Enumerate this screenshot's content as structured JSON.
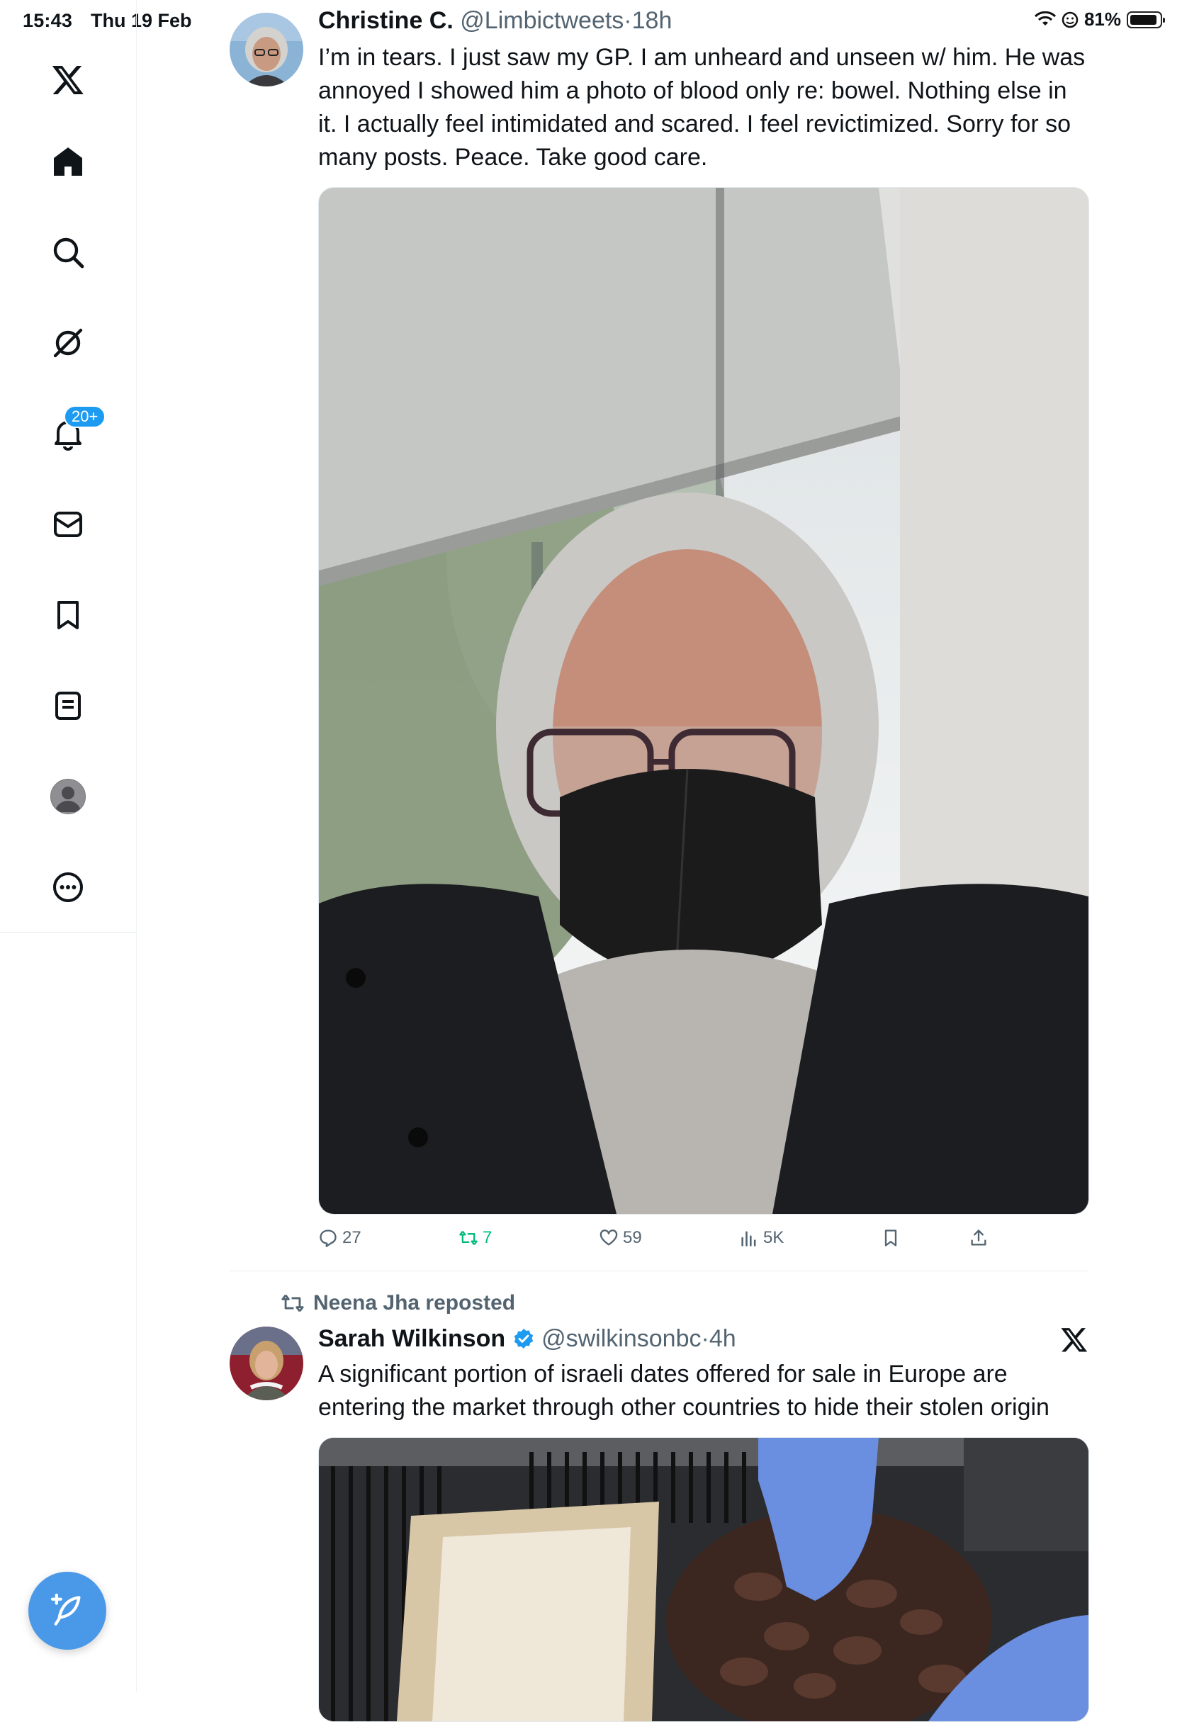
{
  "status_bar": {
    "time": "15:43",
    "date": "Thu 19 Feb",
    "battery": "81%"
  },
  "sidebar": {
    "items": [
      {
        "name": "x-logo-icon"
      },
      {
        "name": "home-icon"
      },
      {
        "name": "search-icon"
      },
      {
        "name": "grok-icon"
      },
      {
        "name": "notifications-icon",
        "badge": "20+"
      },
      {
        "name": "messages-icon"
      },
      {
        "name": "bookmarks-icon"
      },
      {
        "name": "lists-icon"
      },
      {
        "name": "profile-icon"
      },
      {
        "name": "more-icon"
      }
    ]
  },
  "tweets": [
    {
      "display_name": "Christine C.",
      "handle": "@Limbictweets",
      "sep": "·",
      "time": "18h",
      "text": "I’m in tears. I just saw my GP. I am unheard and unseen w/ him. He was annoyed I showed him a photo of blood only re: bowel. Nothing else in it. I actually feel intimidated and scared. I feel revictimized. Sorry for so many posts. Peace. Take good care.",
      "stats": {
        "replies": "27",
        "reposts": "7",
        "likes": "59",
        "views": "5K"
      }
    },
    {
      "reposted_by": "Neena Jha reposted",
      "display_name": "Sarah Wilkinson",
      "handle": "@swilkinsonbc",
      "sep": "·",
      "time": "4h",
      "text": "A significant portion of israeli dates offered for sale in Europe are entering the market through other countries to hide their stolen origin"
    }
  ],
  "colors": {
    "accent": "#1d9bf0",
    "repost_green": "#00ba7c",
    "muted": "#536471",
    "fab": "#4a99e9"
  }
}
